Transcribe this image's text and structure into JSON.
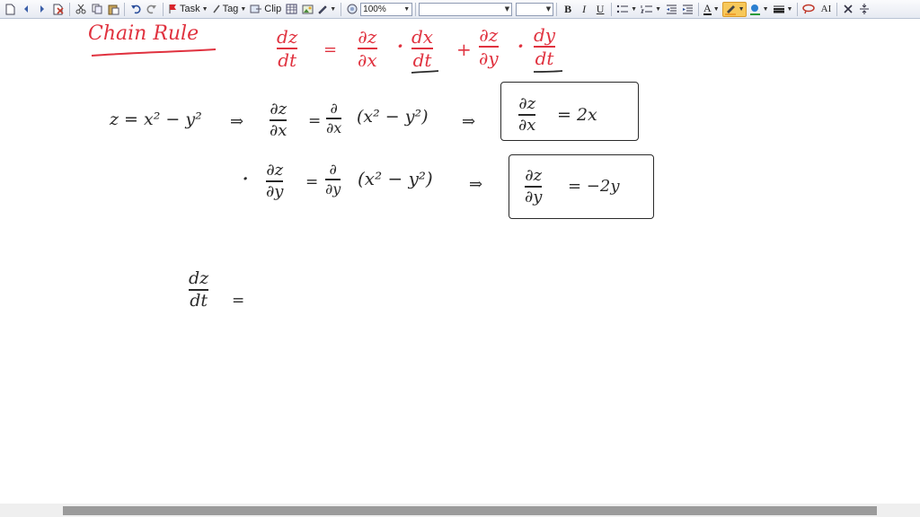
{
  "toolbar": {
    "task_label": "Task",
    "tag_label": "Tag",
    "clip_label": "Clip",
    "zoom_value": "100%",
    "bold_label": "B",
    "italic_label": "I",
    "underline_label": "U",
    "font_color_label": "A",
    "text_style_label": "AI",
    "colors": {
      "pen": "#f0a030",
      "highlight": "#2a9a3a",
      "delete": "#c0392b"
    }
  },
  "notes": {
    "title": "Chain Rule",
    "formula": {
      "lhs_num": "dz",
      "lhs_den": "dt",
      "eq": "=",
      "t1_num": "∂z",
      "t1_den": "∂x",
      "dot": "·",
      "t2_num": "dx",
      "t2_den": "dt",
      "plus": "+",
      "t3_num": "∂z",
      "t3_den": "∂y",
      "t4_num": "dy",
      "t4_den": "dt"
    },
    "line1": {
      "given": "z = x² − y²",
      "implies": "⇒",
      "p_num": "∂z",
      "p_den": "∂x",
      "eq": "=",
      "op_num": "∂",
      "op_den": "∂x",
      "expr": "(x² − y²)",
      "implies2": "⇒",
      "res_num": "∂z",
      "res_den": "∂x",
      "res_value": "= 2x"
    },
    "line2": {
      "bullet": "·",
      "p_num": "∂z",
      "p_den": "∂y",
      "eq": "=",
      "op_num": "∂",
      "op_den": "∂y",
      "expr": "(x² − y²)",
      "implies": "⇒",
      "res_num": "∂z",
      "res_den": "∂y",
      "res_value": "= −2y"
    },
    "line3": {
      "num": "dz",
      "den": "dt",
      "eq": "="
    },
    "ink_colors": {
      "red": "#e0323f",
      "black": "#2a2a2a"
    }
  }
}
